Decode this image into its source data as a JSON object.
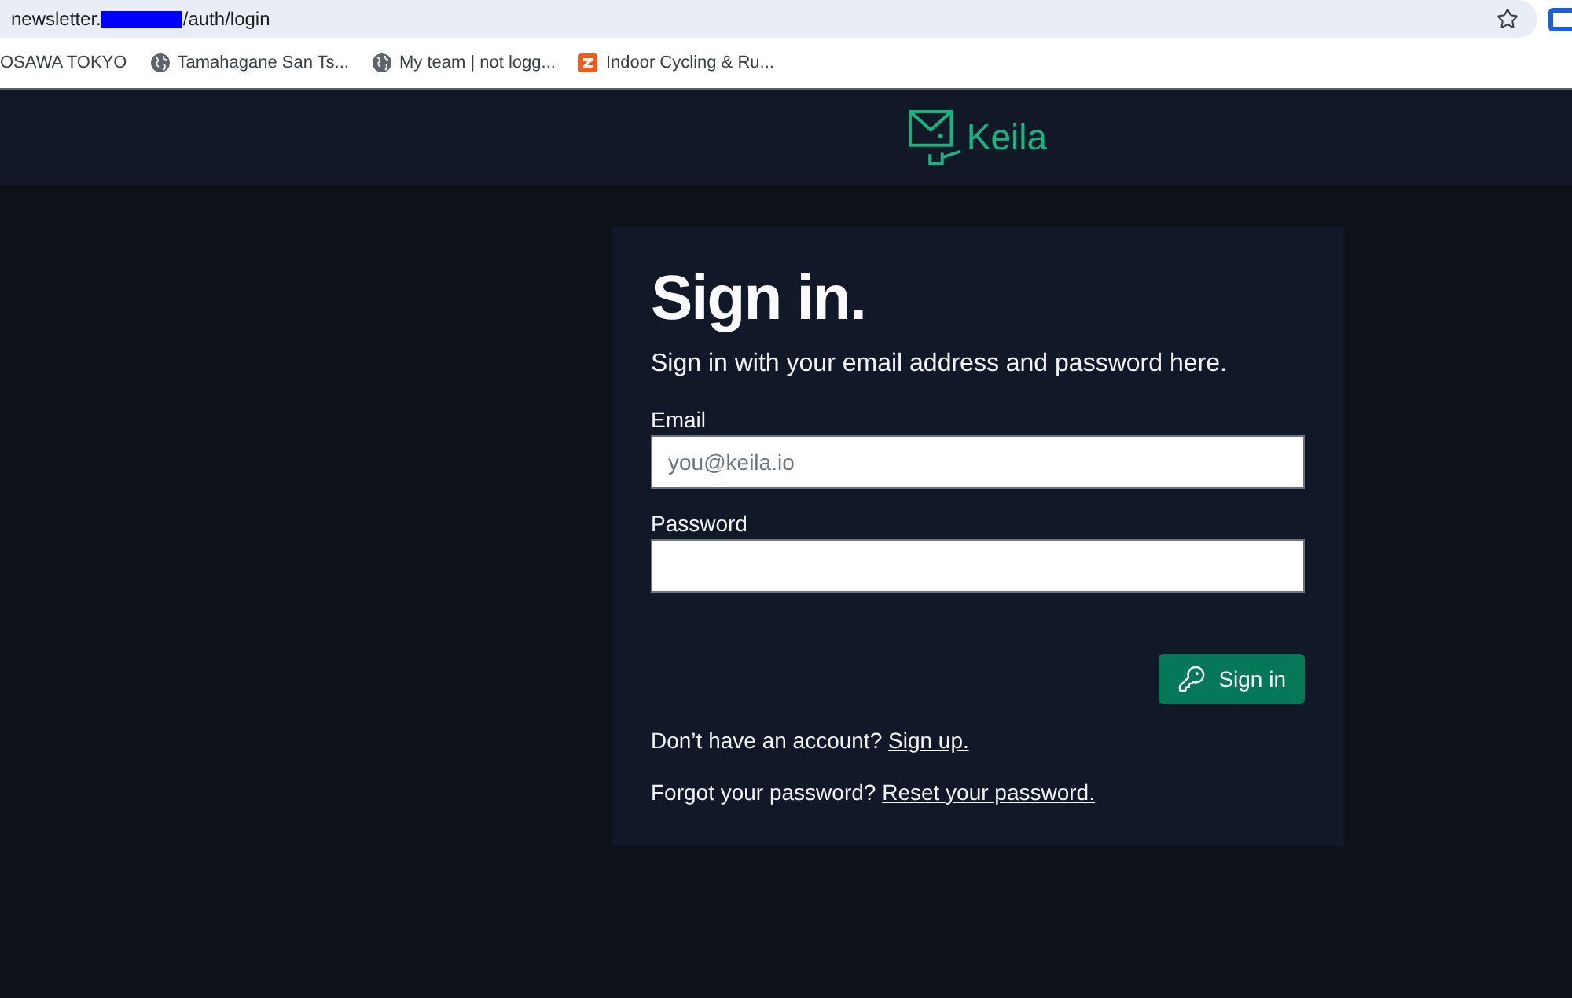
{
  "address_bar": {
    "url_visible_parts": [
      "newsletter.",
      "/auth/login"
    ]
  },
  "bookmarks": [
    {
      "kind": "plain",
      "label": "OSAWA TOKYO"
    },
    {
      "kind": "globe",
      "label": "Tamahagane San Ts..."
    },
    {
      "kind": "globe",
      "label": "My team | not logg..."
    },
    {
      "kind": "app",
      "label": "Indoor Cycling & Ru..."
    }
  ],
  "header": {
    "logo_text": "Keila"
  },
  "sign_in": {
    "title": "Sign in.",
    "subtitle": "Sign in with your email address and password here.",
    "fields": [
      {
        "label": "Email",
        "placeholder": "you@keila.io"
      },
      {
        "label": "Password"
      }
    ],
    "submit_button": "Sign in",
    "footer_links": [
      {
        "text": "Don’t have an account?",
        "link": "Sign up."
      },
      {
        "text": "Forgot your password?",
        "link": "Reset your password."
      }
    ]
  }
}
